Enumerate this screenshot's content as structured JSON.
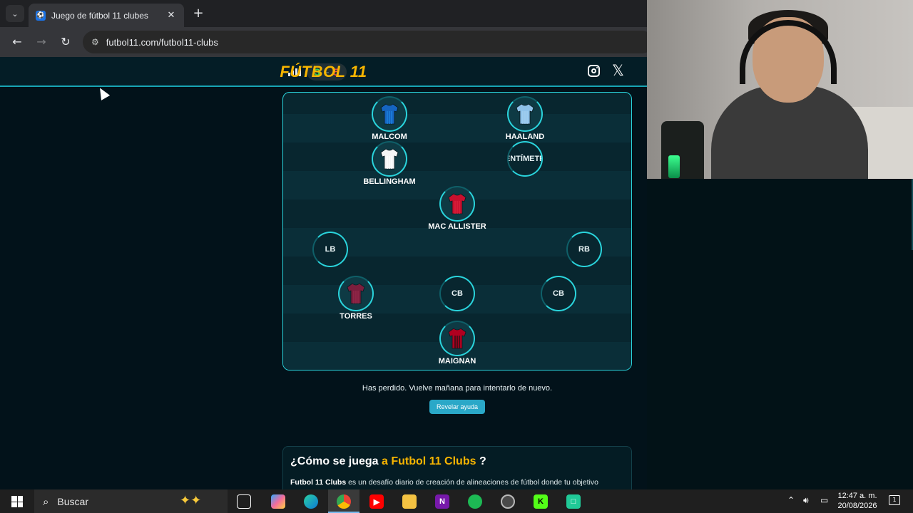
{
  "browser": {
    "tab_title": "Juego de fútbol 11 clubes",
    "favicon_glyph": "⚽",
    "close_glyph": "✕",
    "new_tab_glyph": "+",
    "url": "futbol11.com/futbol11-clubs",
    "back_glyph": "←",
    "forward_glyph": "→",
    "reload_glyph": "↻"
  },
  "site": {
    "logo": "FÚTBOL 11",
    "score_win": "3",
    "score_sep": "–",
    "score_loss": "5",
    "x_glyph": "𝕏",
    "accent_color": "#f7b500",
    "teal_color": "#2ad4dc"
  },
  "pitch": {
    "players": [
      {
        "name": "MALCOM",
        "shirt": "#1565c0",
        "shirt2": "#1e88e5"
      },
      {
        "name": "HAALAND",
        "shirt": "#8fc3ea",
        "shirt2": "#a8d2f0"
      },
      {
        "name": "BELLINGHAM",
        "shirt": "#f5f5f5",
        "shirt2": "#ffffff"
      },
      {
        "name": "ENTÍMETR"
      },
      {
        "name": "MAC ALLISTER",
        "shirt": "#c8102e",
        "shirt2": "#e0253f"
      },
      {
        "label": "LB"
      },
      {
        "label": "RB"
      },
      {
        "name": "TORRES",
        "shirt": "#7b1e3d",
        "shirt2": "#9a2a4e"
      },
      {
        "label": "CB"
      },
      {
        "label": "CB"
      },
      {
        "name": "MAIGNAN",
        "shirt": "#b00020",
        "shirt2": "#111111"
      }
    ]
  },
  "result": {
    "message": "Has perdido. Vuelve mañana para intentarlo de nuevo.",
    "help_button": "Revelar ayuda"
  },
  "how_to": {
    "title_prefix": "¿Cómo se juega",
    "title_accent": "a Futbol 11 Clubs",
    "title_suffix": "?",
    "text_bold": "Futbol 11 Clubs",
    "text_rest": "es un desafío diario de creación de alineaciones de fútbol donde tu objetivo"
  },
  "taskbar": {
    "search_placeholder": "Buscar",
    "time": "12:47 a. m.",
    "date": "20/08/2026",
    "notification_count": "1"
  }
}
